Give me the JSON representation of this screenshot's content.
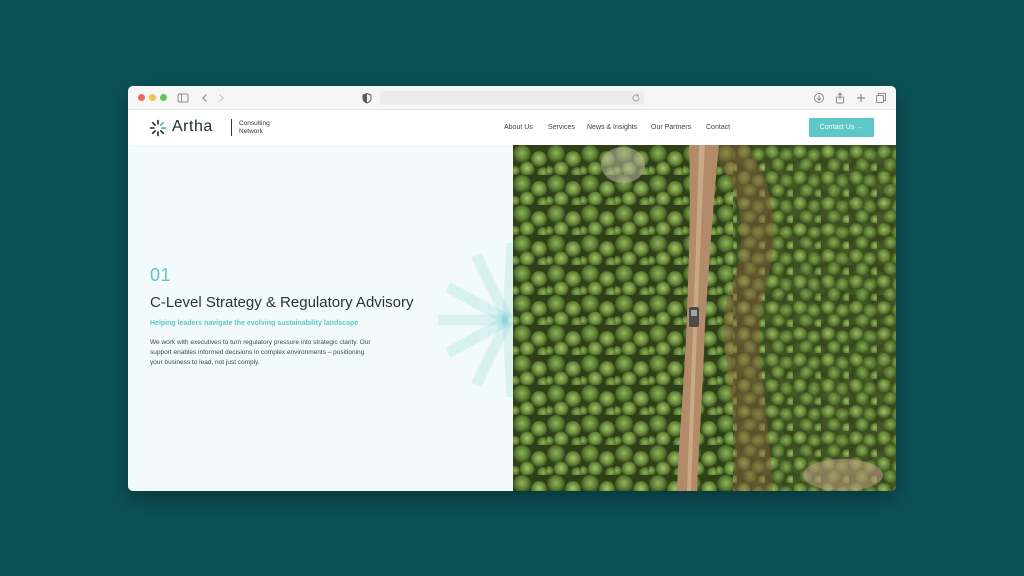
{
  "nav": {
    "items": [
      "About Us",
      "Services",
      "News & Insights",
      "Our Partners",
      "Contact"
    ],
    "cta_label": "Contact Us →"
  },
  "brand": {
    "name": "Artha",
    "subtitle_line1": "Consulting",
    "subtitle_line2": "Network",
    "accent_color": "#5ec7c8"
  },
  "hero": {
    "number": "01",
    "title": "C-Level Strategy & Regulatory Advisory",
    "subtitle": "Helping leaders navigate the evolving sustainability landscape",
    "body": "We work with executives to turn regulatory pressure into strategic clarity. Our support enables informed decisions in complex environments – positioning your business to lead, not just comply."
  },
  "browser": {
    "icons": [
      "sidebar-icon",
      "back-icon",
      "forward-icon",
      "shield-icon",
      "reload-icon",
      "download-icon",
      "share-icon",
      "new-tab-icon",
      "tabs-icon"
    ]
  }
}
